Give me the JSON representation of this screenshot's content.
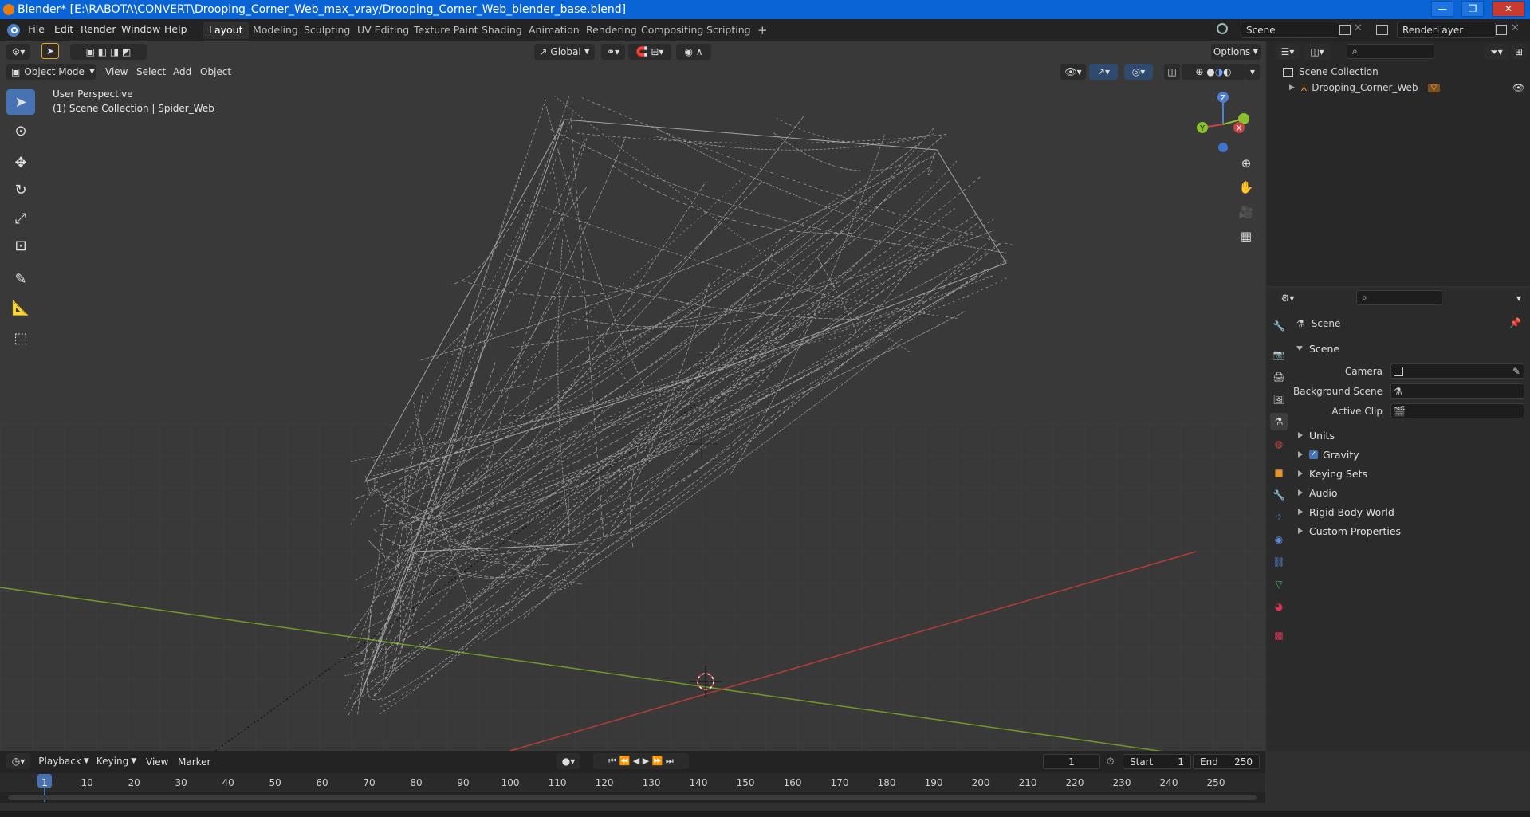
{
  "window": {
    "title": "Blender* [E:\\RABOTA\\CONVERT\\Drooping_Corner_Web_max_vray/Drooping_Corner_Web_blender_base.blend]",
    "minimize": "—",
    "maximize": "❐",
    "close": "✕"
  },
  "menu": [
    "File",
    "Edit",
    "Render",
    "Window",
    "Help"
  ],
  "workspaces": [
    "Layout",
    "Modeling",
    "Sculpting",
    "UV Editing",
    "Texture Paint",
    "Shading",
    "Animation",
    "Rendering",
    "Compositing",
    "Scripting"
  ],
  "workspace_add": "+",
  "scene_field": "Scene",
  "renderlayer_field": "RenderLayer",
  "viewport": {
    "transform_orientation": "Global",
    "options_label": "Options",
    "mode": "Object Mode",
    "header_menus": [
      "View",
      "Select",
      "Add",
      "Object"
    ],
    "info_line1": "User Perspective",
    "info_line2": "(1) Scene Collection | Spider_Web",
    "gizmo_axes": {
      "z": "Z",
      "y": "Y",
      "x": "X"
    }
  },
  "outliner": {
    "root": "Scene Collection",
    "items": [
      {
        "label": "Drooping_Corner_Web"
      }
    ]
  },
  "properties": {
    "context_title": "Scene",
    "panel_title": "Scene",
    "fields": [
      {
        "label": "Camera"
      },
      {
        "label": "Background Scene"
      },
      {
        "label": "Active Clip"
      }
    ],
    "subpanels": [
      "Units",
      "Gravity",
      "Keying Sets",
      "Audio",
      "Rigid Body World",
      "Custom Properties"
    ],
    "gravity_checked": true
  },
  "timeline": {
    "menus": [
      "Playback",
      "Keying",
      "View",
      "Marker"
    ],
    "current_frame": "1",
    "start_label": "Start",
    "start_value": "1",
    "end_label": "End",
    "end_value": "250",
    "ruler": [
      "1",
      "10",
      "20",
      "30",
      "40",
      "50",
      "60",
      "70",
      "80",
      "90",
      "100",
      "110",
      "120",
      "130",
      "140",
      "150",
      "160",
      "170",
      "180",
      "190",
      "200",
      "210",
      "220",
      "230",
      "240",
      "250"
    ]
  },
  "colors": {
    "title_bar": "#0a64d6",
    "active_tool": "#4772b3",
    "x_axis": "#b83a3a",
    "y_axis": "#6f9a2a",
    "object_orange": "#e8922a"
  }
}
